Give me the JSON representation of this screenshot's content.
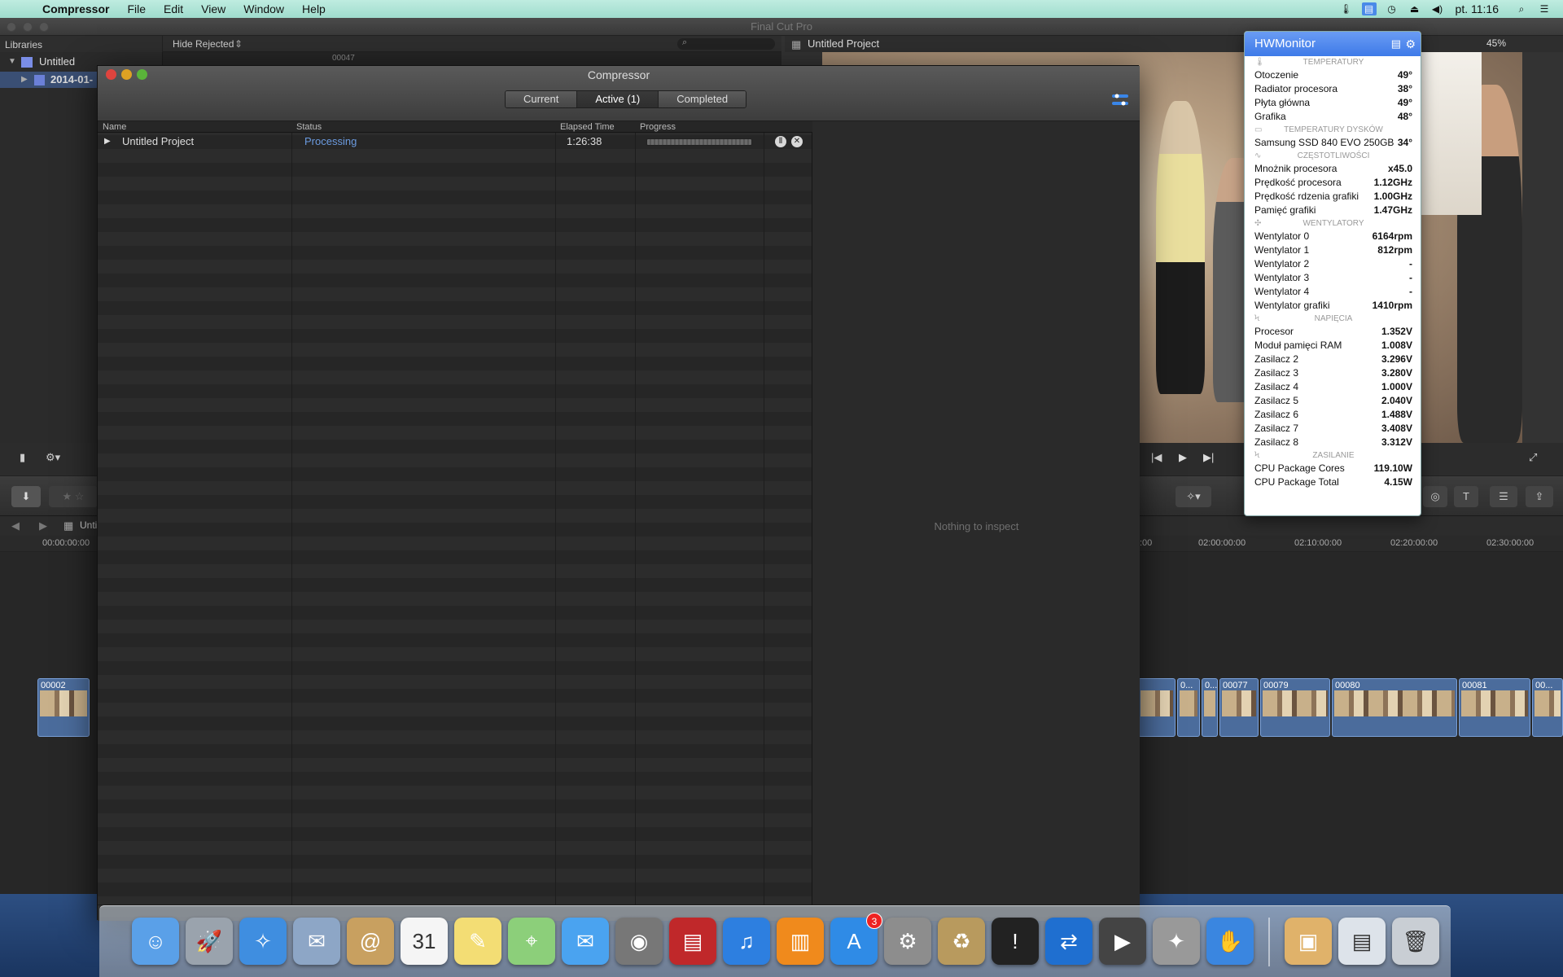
{
  "menubar": {
    "app_name": "Compressor",
    "menus": [
      "File",
      "Edit",
      "View",
      "Window",
      "Help"
    ],
    "clock": "pt. 11:16"
  },
  "fcp": {
    "window_title": "Final Cut Pro",
    "libraries_label": "Libraries",
    "filter_label": "Hide Rejected",
    "browser_item_top": "00047",
    "library_name": "Untitled",
    "event_name": "2014-01-",
    "viewer_title": "Untitled Project",
    "zoom": "45%",
    "timeline_project": "Unti",
    "ruler_left": "00:00:00:00",
    "ruler_marks": [
      ":00",
      "02:00:00:00",
      "02:10:00:00",
      "02:20:00:00",
      "02:30:00:00"
    ],
    "clips_left": [
      "00002"
    ],
    "clips_right": [
      "0...",
      "0...",
      "00077",
      "00079",
      "00080",
      "00081",
      "00..."
    ]
  },
  "compressor": {
    "title": "Compressor",
    "tabs": [
      "Current",
      "Active (1)",
      "Completed"
    ],
    "columns": {
      "name": "Name",
      "status": "Status",
      "elapsed": "Elapsed Time",
      "progress": "Progress"
    },
    "job": {
      "name": "Untitled Project",
      "status": "Processing",
      "elapsed": "1:26:38"
    },
    "inspector_empty": "Nothing to inspect"
  },
  "hwmonitor": {
    "title": "HWMonitor",
    "sections": [
      {
        "title": "TEMPERATURY",
        "icon": "thermometer-icon",
        "rows": [
          {
            "label": "Otoczenie",
            "value": "49°"
          },
          {
            "label": "Radiator procesora",
            "value": "38°"
          },
          {
            "label": "Płyta główna",
            "value": "49°"
          },
          {
            "label": "Grafika",
            "value": "48°"
          }
        ]
      },
      {
        "title": "TEMPERATURY DYSKÓW",
        "icon": "disk-icon",
        "rows": [
          {
            "label": "Samsung SSD 840 EVO 250GB",
            "value": "34°"
          }
        ]
      },
      {
        "title": "CZĘSTOTLIWOŚCI",
        "icon": "pulse-icon",
        "rows": [
          {
            "label": "Mnożnik procesora",
            "value": "x45.0"
          },
          {
            "label": "Prędkość procesora",
            "value": "1.12GHz"
          },
          {
            "label": "Prędkość rdzenia grafiki",
            "value": "1.00GHz"
          },
          {
            "label": "Pamięć grafiki",
            "value": "1.47GHz"
          }
        ]
      },
      {
        "title": "WENTYLATORY",
        "icon": "fan-icon",
        "rows": [
          {
            "label": "Wentylator 0",
            "value": "6164rpm"
          },
          {
            "label": "Wentylator 1",
            "value": "812rpm"
          },
          {
            "label": "Wentylator 2",
            "value": "-"
          },
          {
            "label": "Wentylator 3",
            "value": "-"
          },
          {
            "label": "Wentylator 4",
            "value": "-"
          },
          {
            "label": "Wentylator grafiki",
            "value": "1410rpm"
          }
        ]
      },
      {
        "title": "NAPIĘCIA",
        "icon": "bolt-icon",
        "rows": [
          {
            "label": "Procesor",
            "value": "1.352V"
          },
          {
            "label": "Moduł pamięci RAM",
            "value": "1.008V"
          },
          {
            "label": "Zasilacz 2",
            "value": "3.296V"
          },
          {
            "label": "Zasilacz 3",
            "value": "3.280V"
          },
          {
            "label": "Zasilacz 4",
            "value": "1.000V"
          },
          {
            "label": "Zasilacz 5",
            "value": "2.040V"
          },
          {
            "label": "Zasilacz 6",
            "value": "1.488V"
          },
          {
            "label": "Zasilacz 7",
            "value": "3.408V"
          },
          {
            "label": "Zasilacz 8",
            "value": "3.312V"
          }
        ]
      },
      {
        "title": "ZASILANIE",
        "icon": "power-icon",
        "rows": [
          {
            "label": "CPU Package Cores",
            "value": "119.10W"
          },
          {
            "label": "CPU Package Total",
            "value": "4.15W"
          }
        ]
      }
    ]
  },
  "dock": {
    "items": [
      {
        "name": "finder-icon",
        "color": "#5aa0e8",
        "glyph": "☺"
      },
      {
        "name": "launchpad-icon",
        "color": "#9aa3ad",
        "glyph": "🚀"
      },
      {
        "name": "safari-icon",
        "color": "#3f8ee0",
        "glyph": "✧"
      },
      {
        "name": "mail-icon",
        "color": "#8da6c6",
        "glyph": "✉"
      },
      {
        "name": "contacts-icon",
        "color": "#c8a060",
        "glyph": "@"
      },
      {
        "name": "calendar-icon",
        "color": "#f5f5f5",
        "glyph": "31"
      },
      {
        "name": "notes-icon",
        "color": "#f3dd74",
        "glyph": "✎"
      },
      {
        "name": "maps-icon",
        "color": "#8ccf7a",
        "glyph": "⌖"
      },
      {
        "name": "messages-icon",
        "color": "#4aa3f0",
        "glyph": "✉"
      },
      {
        "name": "facetime-icon",
        "color": "#777",
        "glyph": "◉"
      },
      {
        "name": "photo-booth-icon",
        "color": "#c0282a",
        "glyph": "▤"
      },
      {
        "name": "itunes-icon",
        "color": "#2d7fe0",
        "glyph": "♫"
      },
      {
        "name": "ibooks-icon",
        "color": "#f08a1c",
        "glyph": "▥"
      },
      {
        "name": "app-store-icon",
        "color": "#2f8be6",
        "glyph": "A",
        "badge": "3"
      },
      {
        "name": "system-preferences-icon",
        "color": "#8d8d8d",
        "glyph": "⚙"
      },
      {
        "name": "archive-utility-icon",
        "color": "#b89a5e",
        "glyph": "♻"
      },
      {
        "name": "console-icon",
        "color": "#222",
        "glyph": "!"
      },
      {
        "name": "teamviewer-icon",
        "color": "#1f6fd0",
        "glyph": "⇄"
      },
      {
        "name": "final-cut-pro-icon",
        "color": "#444",
        "glyph": "▶"
      },
      {
        "name": "compressor-icon",
        "color": "#999",
        "glyph": "✦"
      },
      {
        "name": "hwmonitor-icon",
        "color": "#3a86e0",
        "glyph": "✋"
      }
    ],
    "right_items": [
      {
        "name": "applications-folder-icon",
        "color": "#e0b26a",
        "glyph": "▣"
      },
      {
        "name": "downloads-folder-icon",
        "color": "#dde3ea",
        "glyph": "▤"
      },
      {
        "name": "trash-icon",
        "color": "#c9ced4",
        "glyph": "🗑"
      }
    ]
  }
}
